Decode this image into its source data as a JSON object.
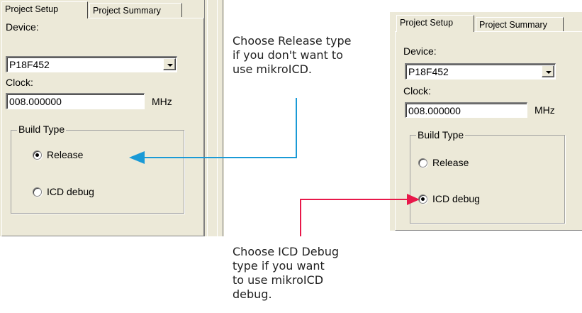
{
  "left_dialog": {
    "tabs": [
      "Project Setup",
      "Project Summary"
    ],
    "device_label": "Device:",
    "device_value": "P18F452",
    "clock_label": "Clock:",
    "clock_value": "008.000000",
    "clock_unit": "MHz",
    "build_type_label": "Build Type",
    "options": [
      "Release",
      "ICD debug"
    ],
    "selected": "Release"
  },
  "right_dialog": {
    "tabs": [
      "Project Setup",
      "Project Summary"
    ],
    "device_label": "Device:",
    "device_value": "P18F452",
    "clock_label": "Clock:",
    "clock_value": "008.000000",
    "clock_unit": "MHz",
    "build_type_label": "Build Type",
    "options": [
      "Release",
      "ICD debug"
    ],
    "selected": "ICD debug"
  },
  "annotations": {
    "release_note": [
      "Choose Release type",
      "if you don't want to",
      "use mikroICD."
    ],
    "icd_note": [
      "Choose ICD Debug",
      "type if you want",
      "to use mikroICD",
      "debug."
    ]
  },
  "colors": {
    "release_arrow": "#1a9ad6",
    "icd_arrow": "#e8184a",
    "dialog_bg": "#ece9d8"
  }
}
